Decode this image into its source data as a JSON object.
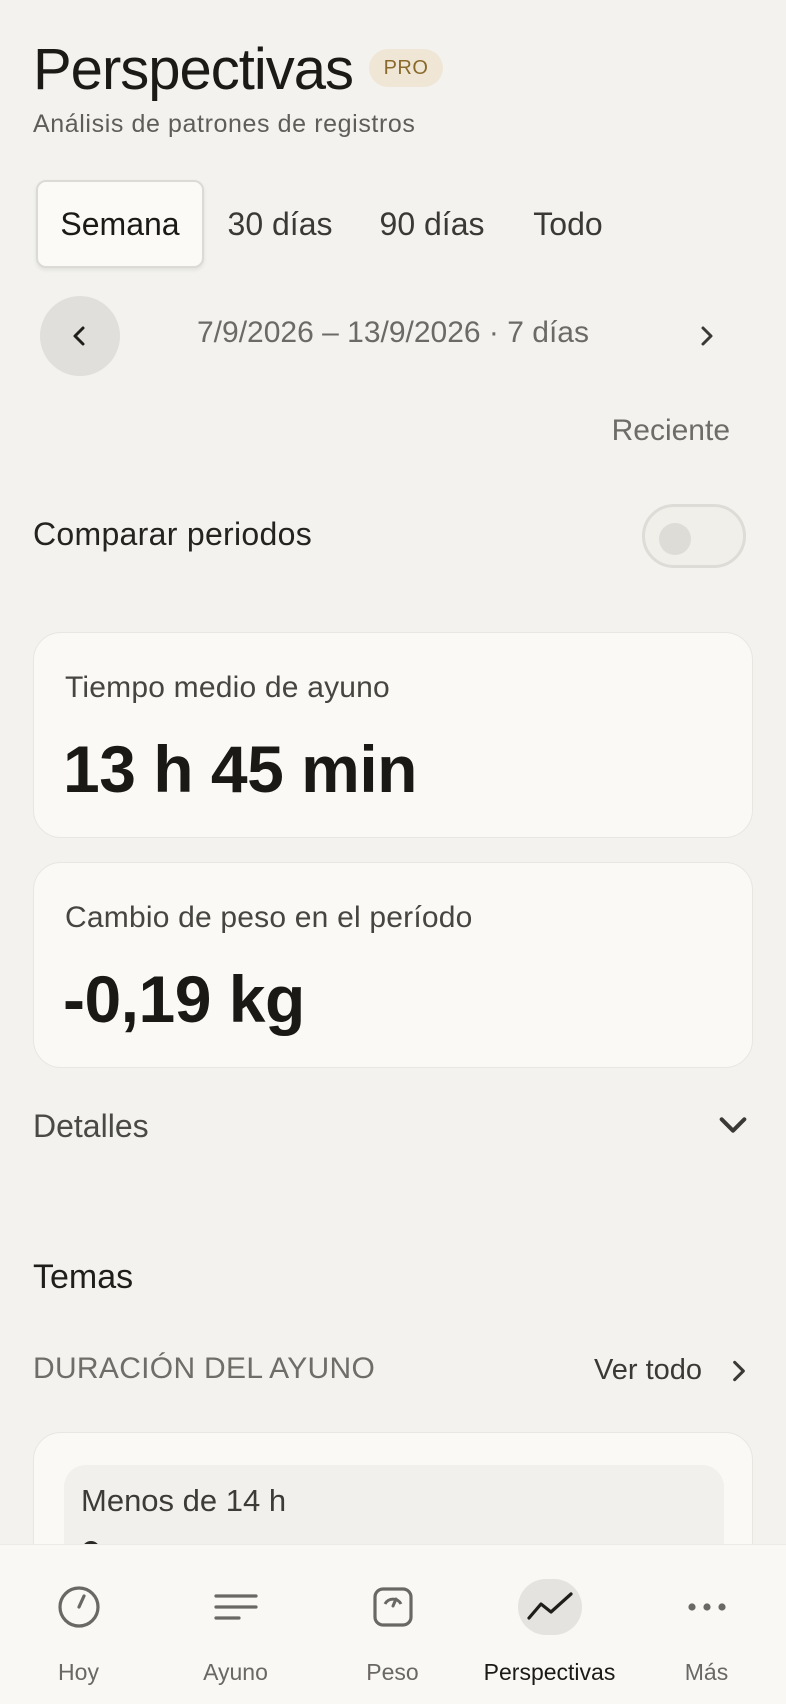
{
  "header": {
    "title": "Perspectivas",
    "badge": "PRO",
    "subtitle": "Análisis de patrones de registros"
  },
  "period_tabs": [
    {
      "label": "Semana",
      "active": true
    },
    {
      "label": "30 días",
      "active": false
    },
    {
      "label": "90 días",
      "active": false
    },
    {
      "label": "Todo",
      "active": false
    }
  ],
  "date_nav": {
    "range": "7/9/2026 – 13/9/2026 · 7 días",
    "recent_label": "Reciente"
  },
  "compare": {
    "label": "Comparar periodos",
    "enabled": false
  },
  "stats": [
    {
      "label": "Tiempo medio de ayuno",
      "value": "13 h 45 min"
    },
    {
      "label": "Cambio de peso en el período",
      "value": "-0,19 kg"
    }
  ],
  "details": {
    "label": "Detalles"
  },
  "themes": {
    "title": "Temas",
    "section_label": "DURACIÓN DEL AYUNO",
    "see_all": "Ver todo",
    "items": [
      {
        "label": "Menos de 14 h"
      }
    ]
  },
  "bottom_nav": [
    {
      "label": "Hoy",
      "icon": "clock-icon",
      "active": false
    },
    {
      "label": "Ayuno",
      "icon": "lines-icon",
      "active": false
    },
    {
      "label": "Peso",
      "icon": "scale-icon",
      "active": false
    },
    {
      "label": "Perspectivas",
      "icon": "trend-icon",
      "active": true
    },
    {
      "label": "Más",
      "icon": "more-icon",
      "active": false
    }
  ],
  "colors": {
    "background": "#f3f2ee",
    "card": "#faf9f6",
    "badge_bg": "#efe6d6",
    "badge_text": "#8a6a2c"
  }
}
